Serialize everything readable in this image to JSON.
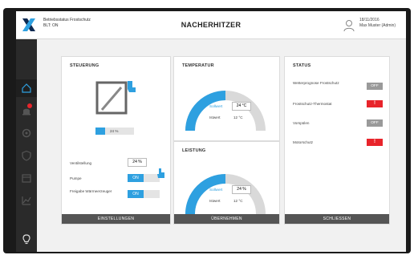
{
  "topbar": {
    "brand_line1": "Betriebsstatus Frostschutz",
    "brand_line2": "BLT: ON",
    "title": "NACHERHITZER",
    "date": "18/11/2016",
    "user": "Max Muster (Admin)"
  },
  "sidebar": {
    "items": [
      {
        "name": "home",
        "icon": "house-icon"
      },
      {
        "name": "alarms",
        "icon": "alarm-icon"
      },
      {
        "name": "settings",
        "icon": "gear-icon"
      },
      {
        "name": "security",
        "icon": "shield-icon"
      },
      {
        "name": "calendar",
        "icon": "calendar-icon"
      },
      {
        "name": "trends",
        "icon": "chart-icon"
      },
      {
        "name": "help",
        "icon": "lightbulb-icon"
      }
    ]
  },
  "steuerung": {
    "title": "STEUERUNG",
    "valve_percent": "24 %",
    "valve_fraction": 0.24,
    "rows": [
      {
        "label": "Ventilstellung",
        "value": "24 %"
      },
      {
        "label": "Pumpe",
        "value": "ON"
      },
      {
        "label": "Freigabe Wärmeerzeuger",
        "value": "ON"
      }
    ],
    "button": "EINSTELLUNGEN"
  },
  "temperatur": {
    "title": "TEMPERATUR",
    "soll_label": "Sollwert",
    "soll_value": "24 °C",
    "ist_label": "Istwert",
    "ist_value": "12 °C",
    "fill_fraction": 0.5
  },
  "leistung": {
    "title": "LEISTUNG",
    "soll_label": "Sollwert",
    "soll_value": "24 %",
    "ist_label": "Istwert",
    "ist_value": "12 °C",
    "fill_fraction": 0.5
  },
  "uebernehmen_button": "ÜBERNEHMEN",
  "status": {
    "title": "STATUS",
    "items": [
      {
        "label": "Wetterprognose Frostschutz",
        "state": "OFF"
      },
      {
        "label": "Frostschutz-Thermostat",
        "state": "!"
      },
      {
        "label": "Vorspülen",
        "state": "OFF"
      },
      {
        "label": "Motorschutz",
        "state": "!"
      }
    ],
    "button": "SCHLIESSEN"
  },
  "colors": {
    "accent": "#2ea0e0",
    "alarm": "#e8242b",
    "off": "#9a9a9a",
    "sidebar": "#2a2a2a"
  }
}
